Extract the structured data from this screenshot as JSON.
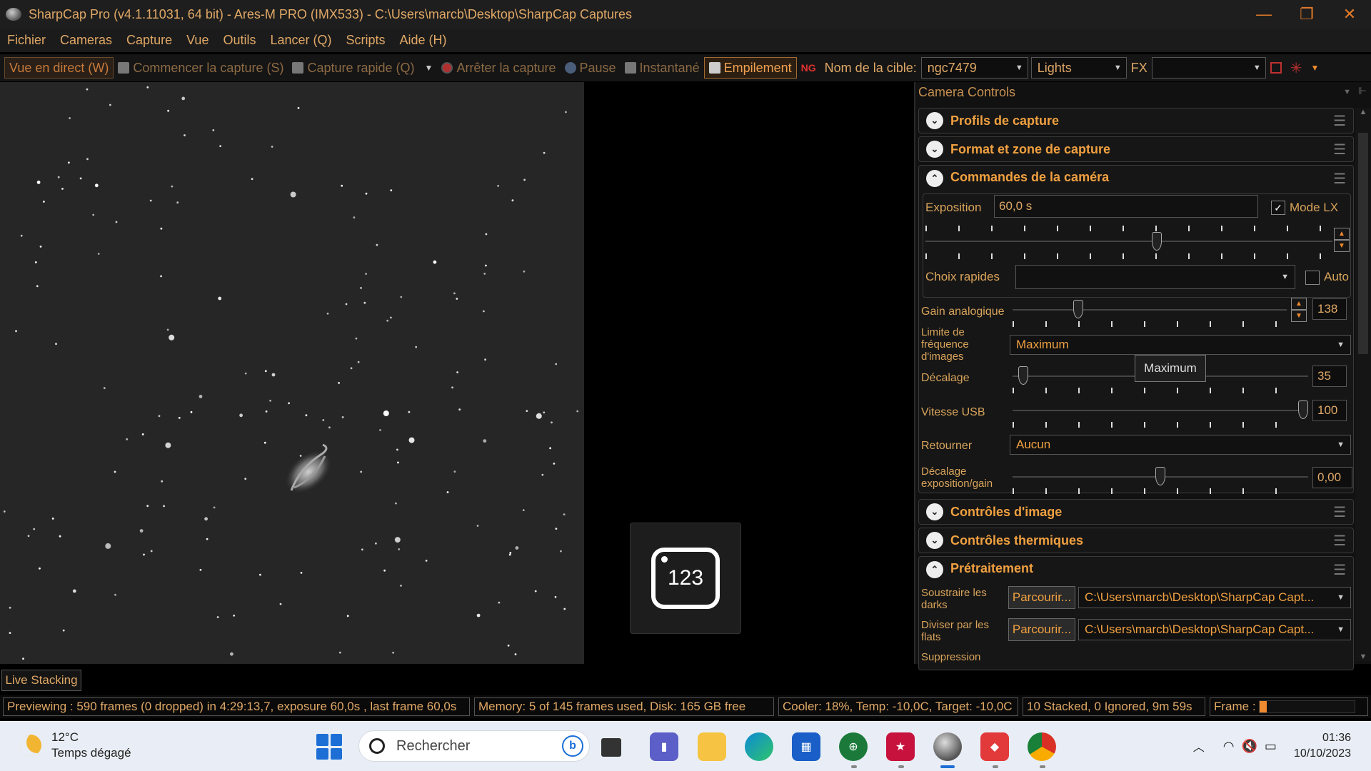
{
  "window": {
    "title": "SharpCap Pro (v4.1.11031, 64 bit) - Ares-M PRO (IMX533) - C:\\Users\\marcb\\Desktop\\SharpCap Captures",
    "minimize": "—",
    "restore": "❐",
    "close": "✕"
  },
  "menu": [
    "Fichier",
    "Cameras",
    "Capture",
    "Vue",
    "Outils",
    "Lancer (Q)",
    "Scripts",
    "Aide (H)"
  ],
  "toolbar": {
    "live_view": "Vue en direct (W)",
    "start_capture": "Commencer la capture (S)",
    "quick_capture": "Capture rapide (Q)",
    "stop_capture": "Arrêter la capture",
    "pause": "Pause",
    "snapshot": "Instantané",
    "stacking": "Empilement",
    "target_label": "Nom de la cible:",
    "target_value": "ngc7479",
    "frame_type": "Lights",
    "fx_label": "FX",
    "fx_value": ""
  },
  "panel": {
    "title": "Camera Controls",
    "sections": {
      "profiles": "Profils de capture",
      "format": "Format et zone de capture",
      "camera_controls": "Commandes de la caméra",
      "image_controls": "Contrôles d'image",
      "thermal": "Contrôles thermiques",
      "preprocessing": "Prétraitement"
    },
    "exposure": {
      "label": "Exposition",
      "value": "60,0 s",
      "lx_mode": "Mode LX",
      "lx_checked": true,
      "slider_fraction": 0.57
    },
    "quick_choices": {
      "label": "Choix rapides",
      "value": "",
      "auto": "Auto"
    },
    "analog_gain": {
      "label": "Gain analogique",
      "value": "138",
      "slider_fraction": 0.23
    },
    "frame_rate_limit": {
      "label_1": "Limite de",
      "label_2": "fréquence",
      "label_3": "d'images",
      "value": "Maximum",
      "tooltip": "Maximum"
    },
    "offset": {
      "label": "Décalage",
      "value": "35",
      "slider_fraction": 0.02
    },
    "usb_speed": {
      "label": "Vitesse USB",
      "value": "100",
      "slider_fraction": 1.0
    },
    "flip": {
      "label": "Retourner",
      "value": "Aucun"
    },
    "exposure_gain_offset": {
      "label_1": "Décalage",
      "label_2": "exposition/gain",
      "value": "0,00",
      "slider_fraction": 0.5
    },
    "subtract_darks": {
      "label_1": "Soustraire les",
      "label_2": "darks",
      "browse": "Parcourir...",
      "path": "C:\\Users\\marcb\\Desktop\\SharpCap Capt..."
    },
    "divide_flats": {
      "label_1": "Diviser par les",
      "label_2": "flats",
      "browse": "Parcourir...",
      "path": "C:\\Users\\marcb\\Desktop\\SharpCap Capt..."
    },
    "suppression": "Suppression"
  },
  "live_stacking_tab": "Live Stacking",
  "status": {
    "preview": "Previewing : 590 frames (0 dropped) in 4:29:13,7, exposure 60,0s , last frame 60,0s",
    "memory": "Memory: 5 of 145 frames used, Disk: 165 GB free",
    "cooler": "Cooler: 18%, Temp: -10,0C, Target: -10,0C",
    "stacked": "10 Stacked, 0 Ignored, 9m 59s",
    "frame_label": "Frame :",
    "frame_progress": 0.08,
    "accent": "#f08a30"
  },
  "widget": {
    "number": "123"
  },
  "taskbar": {
    "temperature": "12°C",
    "weather": "Temps dégagé",
    "search_placeholder": "Rechercher",
    "bing": "b",
    "time": "01:36",
    "date": "10/10/2023",
    "apps": [
      "task-view-icon",
      "chat-icon",
      "file-explorer-icon",
      "edge-icon",
      "store-icon",
      "phd-guiding-icon",
      "astro-app-icon",
      "sharpcap-icon",
      "anydesk-icon",
      "chrome-icon"
    ]
  }
}
